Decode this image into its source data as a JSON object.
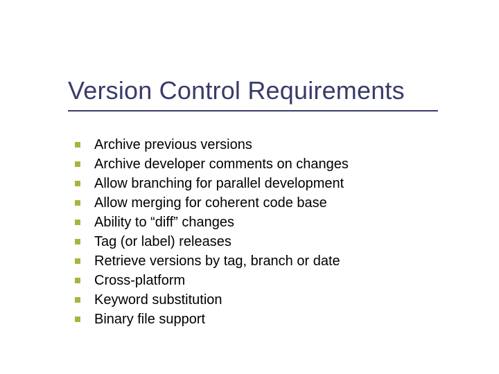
{
  "slide": {
    "title": "Version Control Requirements",
    "items": [
      {
        "text": "Archive previous versions"
      },
      {
        "text": "Archive developer comments on changes"
      },
      {
        "text": "Allow branching for parallel development"
      },
      {
        "text": "Allow merging for coherent code base"
      },
      {
        "text": "Ability to “diff” changes"
      },
      {
        "text": "Tag (or label) releases"
      },
      {
        "text": "Retrieve versions by tag, branch or date"
      },
      {
        "text": "Cross-platform"
      },
      {
        "text": "Keyword substitution"
      },
      {
        "text": "Binary file support"
      }
    ]
  }
}
